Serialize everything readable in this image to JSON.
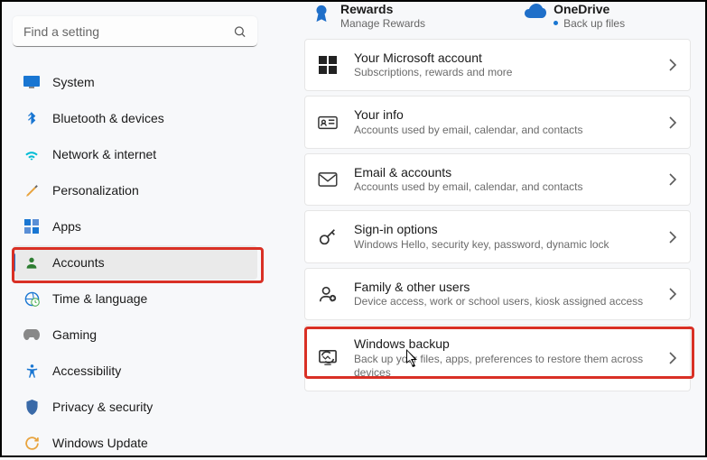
{
  "sidebar": {
    "search_placeholder": "Find a setting",
    "items": [
      {
        "label": "System"
      },
      {
        "label": "Bluetooth & devices"
      },
      {
        "label": "Network & internet"
      },
      {
        "label": "Personalization"
      },
      {
        "label": "Apps"
      },
      {
        "label": "Accounts"
      },
      {
        "label": "Time & language"
      },
      {
        "label": "Gaming"
      },
      {
        "label": "Accessibility"
      },
      {
        "label": "Privacy & security"
      },
      {
        "label": "Windows Update"
      }
    ]
  },
  "top": {
    "rewards": {
      "title": "Rewards",
      "subtitle": "Manage Rewards"
    },
    "onedrive": {
      "title": "OneDrive",
      "subtitle": "Back up files"
    }
  },
  "cards": [
    {
      "title": "Your Microsoft account",
      "subtitle": "Subscriptions, rewards and more"
    },
    {
      "title": "Your info",
      "subtitle": "Accounts used by email, calendar, and contacts"
    },
    {
      "title": "Email & accounts",
      "subtitle": "Accounts used by email, calendar, and contacts"
    },
    {
      "title": "Sign-in options",
      "subtitle": "Windows Hello, security key, password, dynamic lock"
    },
    {
      "title": "Family & other users",
      "subtitle": "Device access, work or school users, kiosk assigned access"
    },
    {
      "title": "Windows backup",
      "subtitle": "Back up your files, apps, preferences to restore them across devices"
    }
  ]
}
